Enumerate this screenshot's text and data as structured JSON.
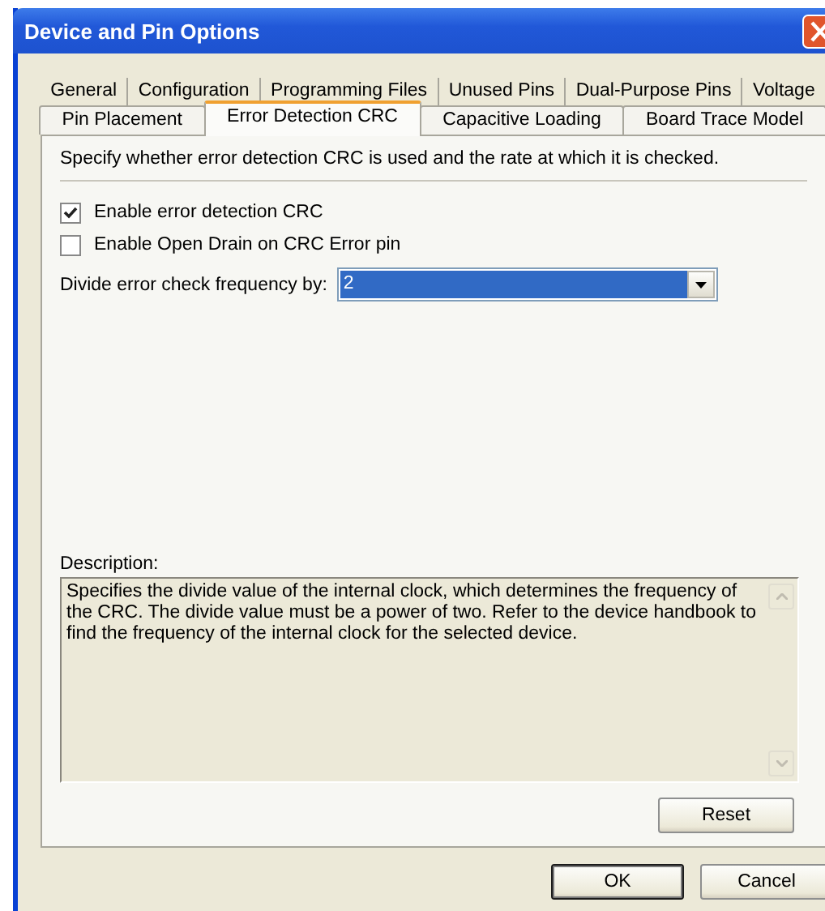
{
  "window": {
    "title": "Device and Pin Options"
  },
  "tab_rows": [
    {
      "tabs": [
        {
          "label": "General",
          "selected": false
        },
        {
          "label": "Configuration",
          "selected": false
        },
        {
          "label": "Programming Files",
          "selected": false
        },
        {
          "label": "Unused Pins",
          "selected": false
        },
        {
          "label": "Dual-Purpose Pins",
          "selected": false
        },
        {
          "label": "Voltage",
          "selected": false
        }
      ]
    },
    {
      "tabs": [
        {
          "label": "Pin Placement",
          "selected": false
        },
        {
          "label": "Error Detection CRC",
          "selected": true
        },
        {
          "label": "Capacitive Loading",
          "selected": false
        },
        {
          "label": "Board Trace Model",
          "selected": false
        }
      ]
    }
  ],
  "intro": "Specify whether error detection CRC is used and the rate at which it is checked.",
  "checkboxes": [
    {
      "label": "Enable error detection CRC",
      "checked": true
    },
    {
      "label": "Enable Open Drain on CRC Error pin",
      "checked": false
    }
  ],
  "frequency": {
    "label": "Divide error check frequency by:",
    "value": "2"
  },
  "description": {
    "label": "Description:",
    "text": "Specifies the divide value of the internal clock, which determines the frequency of the CRC. The divide value must be a power of two. Refer to the device handbook to find the frequency of the internal clock for the selected device."
  },
  "reset_button": "Reset",
  "dialog_buttons": [
    {
      "label": "OK",
      "default": true
    },
    {
      "label": "Cancel",
      "default": false
    }
  ]
}
